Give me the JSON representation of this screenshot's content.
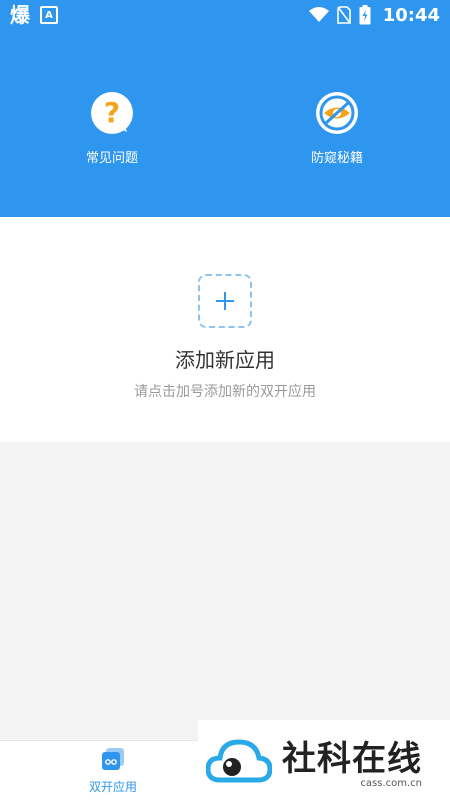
{
  "status_bar": {
    "app_glyph": "爆",
    "a_icon_label": "A",
    "time": "10:44"
  },
  "header": {
    "items": [
      {
        "label": "常见问题",
        "icon": "question-bubble-icon"
      },
      {
        "label": "防窥秘籍",
        "icon": "no-eye-icon"
      }
    ]
  },
  "main": {
    "add_title": "添加新应用",
    "add_subtitle": "请点击加号添加新的双开应用"
  },
  "bottom_nav": {
    "items": [
      {
        "label": "双开应用",
        "icon": "dual-app-icon",
        "active": true
      }
    ]
  },
  "watermark": {
    "title": "社科在线",
    "url": "cass.com.cn"
  },
  "colors": {
    "primary": "#2e96ee",
    "accent_orange": "#f5a31a",
    "dashed_border": "#8cc4f0"
  }
}
